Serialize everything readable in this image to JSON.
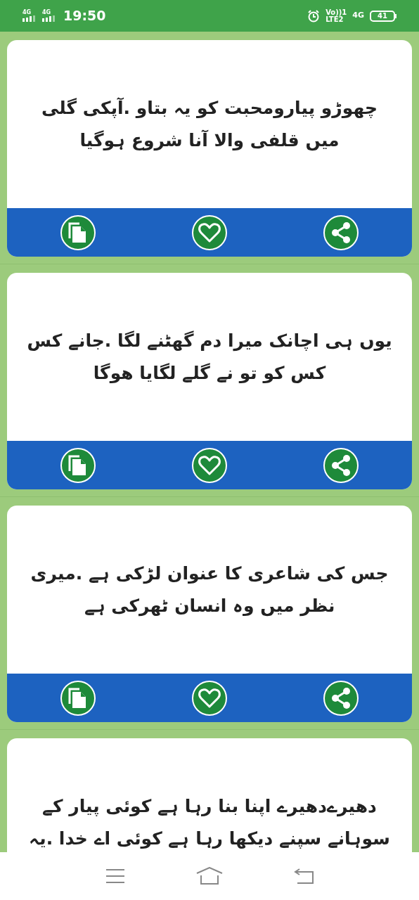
{
  "status_bar": {
    "sim_1": "4G",
    "sim_2": "4G",
    "time": "19:50",
    "volte": "Vo))1",
    "lte": "LTE2",
    "network": "4G",
    "battery": "41"
  },
  "cards": [
    {
      "lines": [
        "چھوڑو پیارومحبت کو یہ بتاو .آپکی گلی",
        "میں قلفی والا آنا شروع ہوگیا"
      ]
    },
    {
      "lines": [
        "یوں ہی اچانک میرا دم گھٹنے لگا .جانے کس",
        "کس کو تو نے گلے لگایا ھوگا"
      ]
    },
    {
      "lines": [
        "جس کی شاعری کا عنوان لڑکی ہے  .میری",
        "نظر میں وہ انسان ٹھرکی ہے"
      ]
    },
    {
      "lines": [
        "دھیرےدھیرے اپنا بنا رہا ہے کوئی  پیار کے",
        "سوہانے سپنے دیکھا رہا ہے کوئی  اے خدا .یہ"
      ]
    }
  ]
}
